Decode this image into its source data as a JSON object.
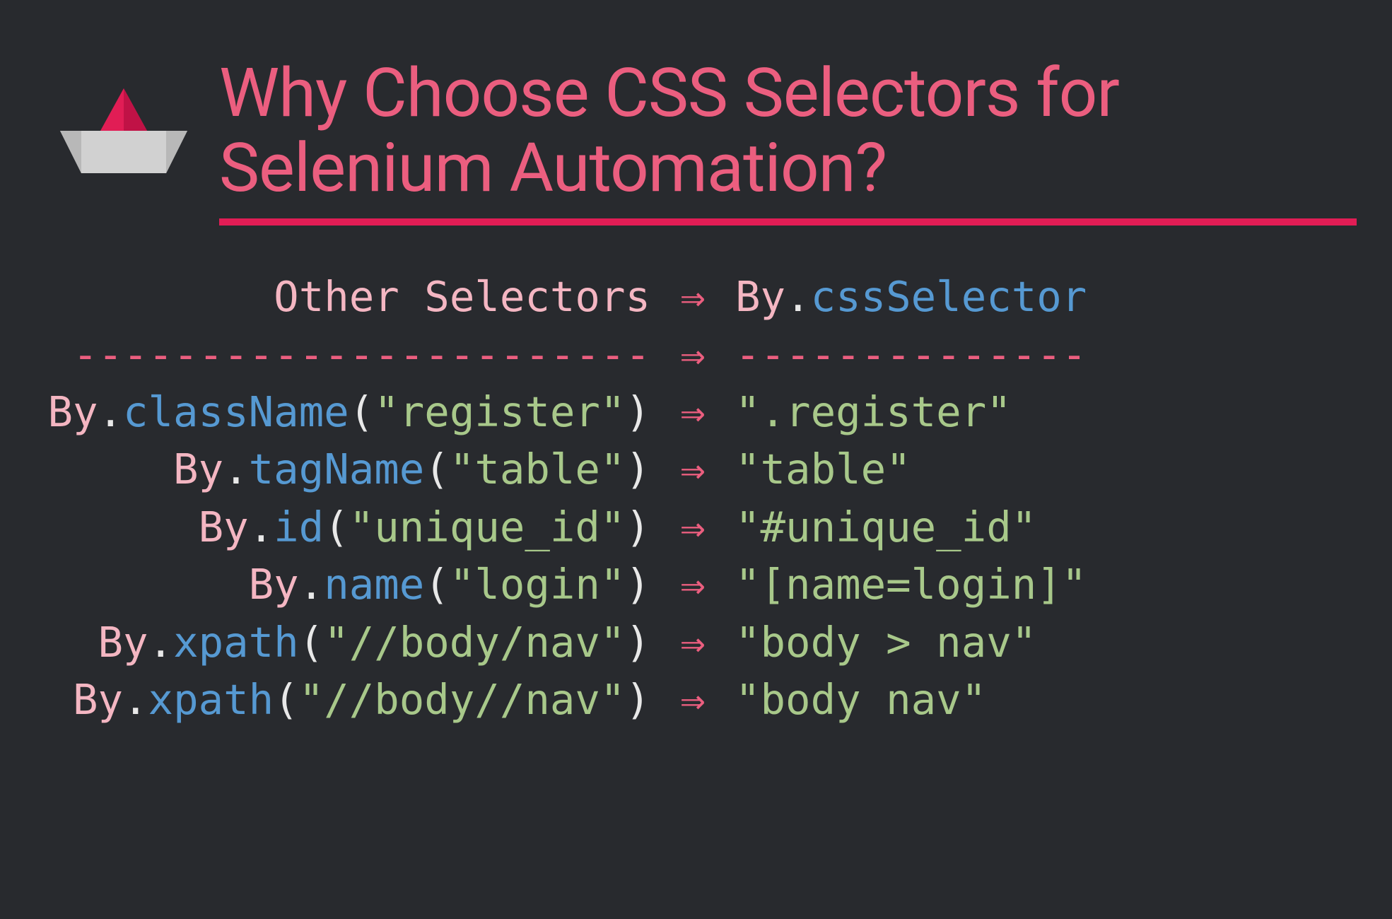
{
  "title": "Why Choose CSS Selectors for Selenium Automation?",
  "header": {
    "left": "Other Selectors",
    "right_by": "By",
    "right_dot": ".",
    "right_method": "cssSelector"
  },
  "divider": {
    "left": "-----------------------",
    "right": "--------------"
  },
  "arrow": "⇒",
  "rows": [
    {
      "by": "By",
      "dot": ".",
      "method": "className",
      "paren_open": "(",
      "arg": "\"register\"",
      "paren_close": ")",
      "css": "\".register\""
    },
    {
      "by": "By",
      "dot": ".",
      "method": "tagName",
      "paren_open": "(",
      "arg": "\"table\"",
      "paren_close": ")",
      "css": "\"table\""
    },
    {
      "by": "By",
      "dot": ".",
      "method": "id",
      "paren_open": "(",
      "arg": "\"unique_id\"",
      "paren_close": ")",
      "css": "\"#unique_id\""
    },
    {
      "by": "By",
      "dot": ".",
      "method": "name",
      "paren_open": "(",
      "arg": "\"login\"",
      "paren_close": ")",
      "css": "\"[name=login]\""
    },
    {
      "by": "By",
      "dot": ".",
      "method": "xpath",
      "paren_open": "(",
      "arg": "\"//body/nav\"",
      "paren_close": ")",
      "css": "\"body > nav\""
    },
    {
      "by": "By",
      "dot": ".",
      "method": "xpath",
      "paren_open": "(",
      "arg": "\"//body//nav\"",
      "paren_close": ")",
      "css": "\"body nav\""
    }
  ]
}
